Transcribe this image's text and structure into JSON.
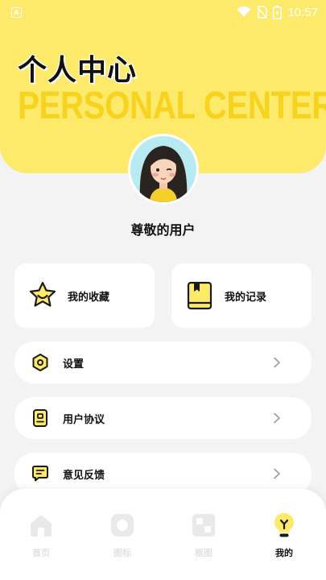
{
  "status_bar": {
    "time": "10:57",
    "app_icon_letter": "A"
  },
  "header": {
    "title_cn": "个人中心",
    "title_en": "PERSONAL CENTER"
  },
  "profile": {
    "username": "尊敬的用户"
  },
  "quick_actions": [
    {
      "label": "我的收藏",
      "icon": "star-icon"
    },
    {
      "label": "我的记录",
      "icon": "book-icon"
    }
  ],
  "menu": [
    {
      "label": "设置",
      "icon": "settings-icon"
    },
    {
      "label": "用户协议",
      "icon": "agreement-icon"
    },
    {
      "label": "意见反馈",
      "icon": "feedback-icon"
    }
  ],
  "bottom_nav": [
    {
      "label": "首页",
      "icon": "home-icon",
      "active": false
    },
    {
      "label": "图标",
      "icon": "icon-tab-icon",
      "active": false
    },
    {
      "label": "框图",
      "icon": "frame-icon",
      "active": false
    },
    {
      "label": "我的",
      "icon": "bulb-icon",
      "active": true
    }
  ],
  "colors": {
    "accent": "#fde96a",
    "accent_dark": "#f7d21e",
    "page_bg": "#f3f3f3",
    "text": "#111111",
    "inactive": "#e2e2e2"
  }
}
